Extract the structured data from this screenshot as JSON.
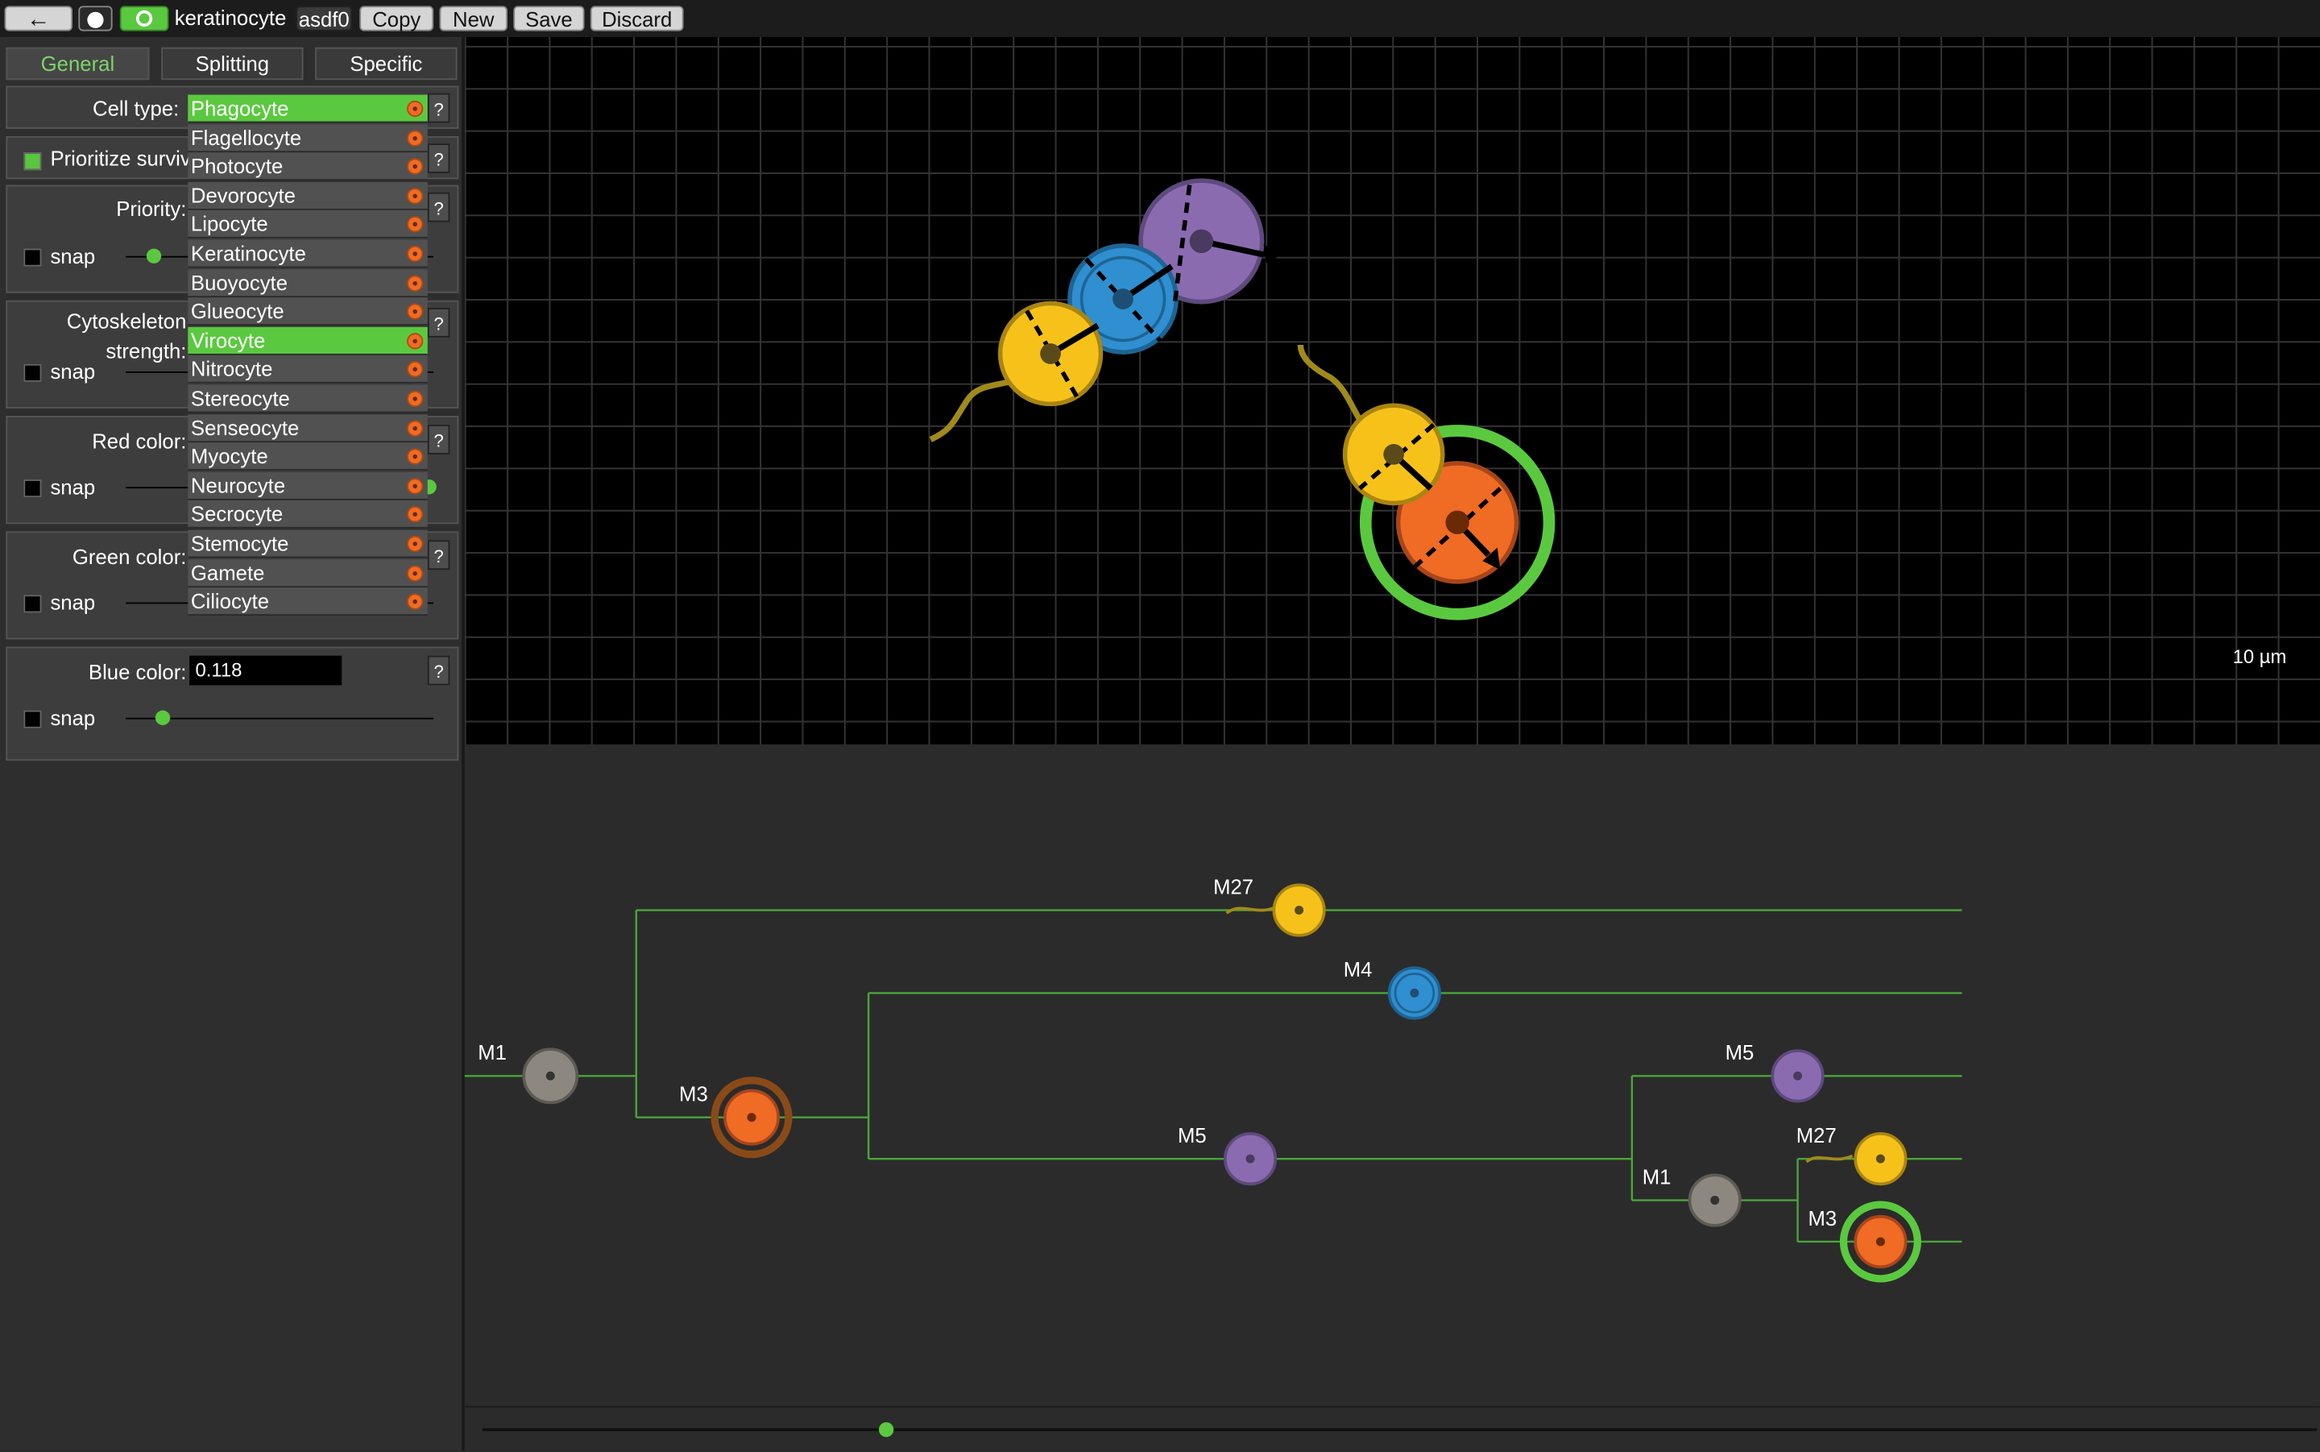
{
  "toolbar": {
    "back_icon": "arrow-left-icon",
    "circle_icon": "circle-icon",
    "cell_icon": "cell-icon",
    "genome_name": "keratinocyte",
    "genome_value": "asdf0",
    "copy_label": "Copy",
    "new_label": "New",
    "save_label": "Save",
    "discard_label": "Discard"
  },
  "tabs": [
    {
      "label": "General",
      "active": true
    },
    {
      "label": "Splitting",
      "active": false
    },
    {
      "label": "Specific",
      "active": false
    }
  ],
  "form": {
    "cell_type_label": "Cell type:",
    "prioritize_label": "Prioritize survival",
    "prioritize_checked": true,
    "priority_label": "Priority:",
    "cytoskeleton_label": "Cytoskeleton strength:",
    "cytoskeleton_label_1": "Cytoskeleton",
    "cytoskeleton_label_2": "strength:",
    "red_label": "Red color:",
    "green_label": "Green color:",
    "blue_label": "Blue color:",
    "blue_value": "0.118",
    "snap_label": "snap",
    "help": "?"
  },
  "cell_types": [
    {
      "label": "Phagocyte",
      "selected": true
    },
    {
      "label": "Flagellocyte"
    },
    {
      "label": "Photocyte"
    },
    {
      "label": "Devorocyte"
    },
    {
      "label": "Lipocyte"
    },
    {
      "label": "Keratinocyte"
    },
    {
      "label": "Buoyocyte"
    },
    {
      "label": "Glueocyte"
    },
    {
      "label": "Virocyte",
      "highlighted": true
    },
    {
      "label": "Nitrocyte"
    },
    {
      "label": "Stereocyte"
    },
    {
      "label": "Senseocyte"
    },
    {
      "label": "Myocyte"
    },
    {
      "label": "Neurocyte"
    },
    {
      "label": "Secrocyte"
    },
    {
      "label": "Stemocyte"
    },
    {
      "label": "Gamete"
    },
    {
      "label": "Ciliocyte"
    }
  ],
  "viewport": {
    "scale_label": "10 µm"
  },
  "tree_nodes": {
    "m1_root": "M1",
    "m3": "M3",
    "m27_top": "M27",
    "m4": "M4",
    "m5_mid": "M5",
    "m5_right": "M5",
    "m1_right": "M1",
    "m27_right": "M27",
    "m3_right": "M3"
  },
  "timeline": {
    "position": 0.22
  },
  "colors": {
    "accent_green": "#5bc940",
    "yellow_cell": "#f6c21a",
    "blue_cell": "#2f8fd0",
    "purple_cell": "#8a6bb0",
    "orange_cell": "#f06b24",
    "grey_cell": "#8c8880"
  }
}
